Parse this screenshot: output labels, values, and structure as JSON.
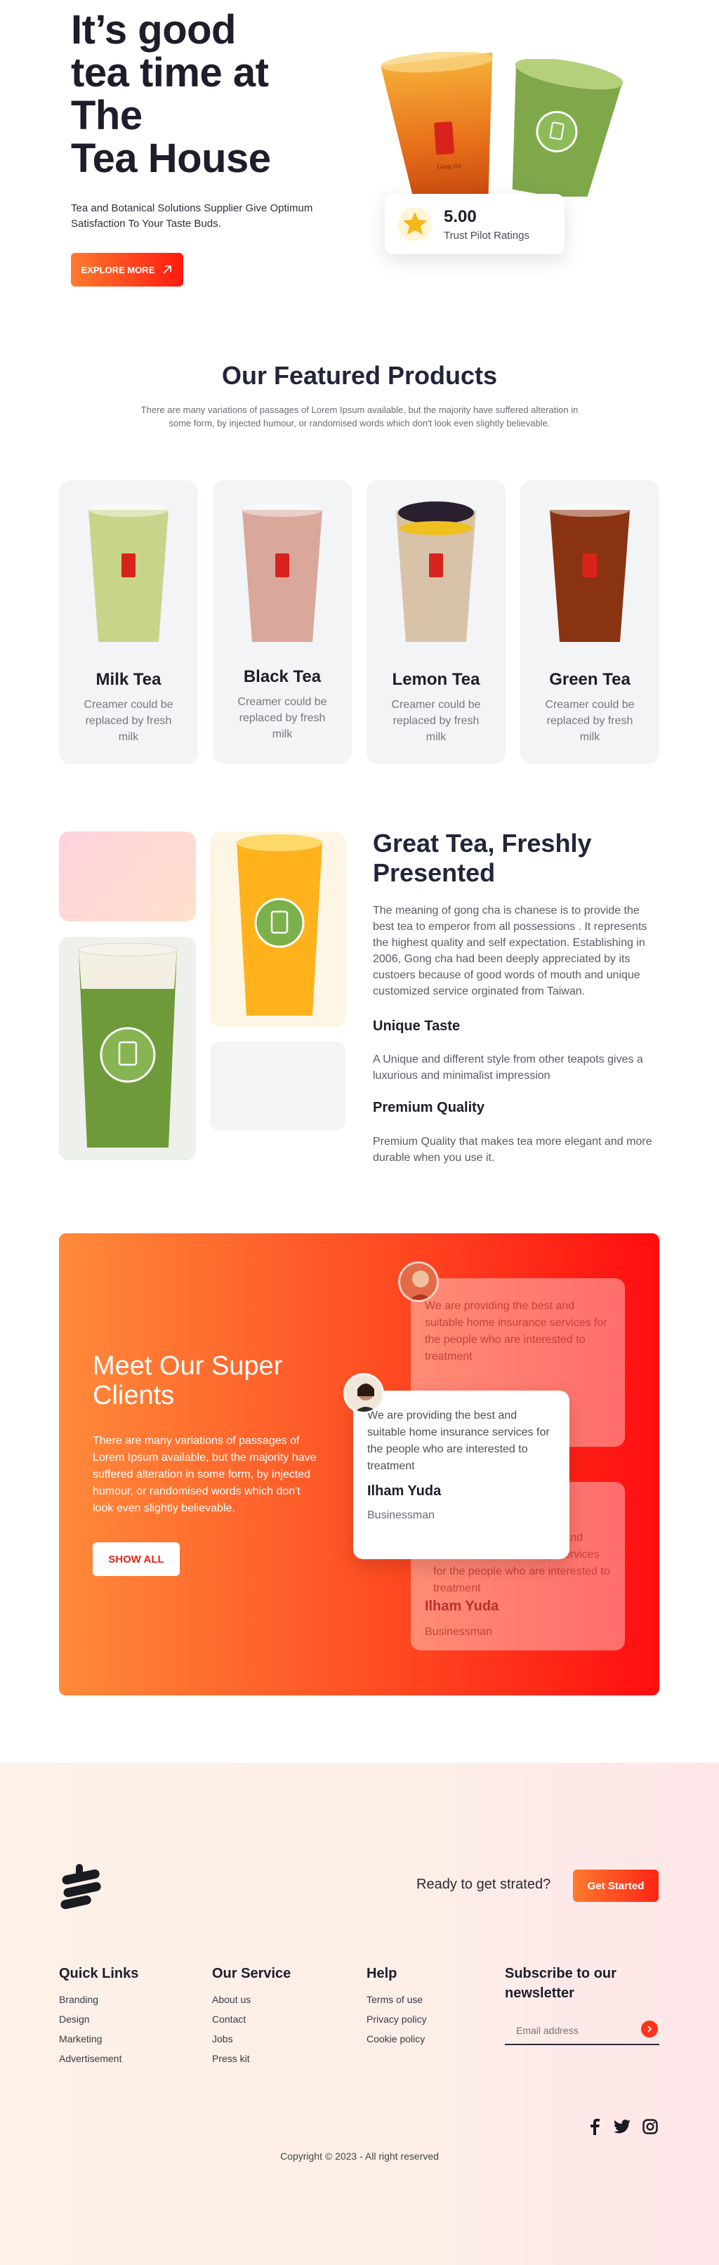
{
  "hero": {
    "title": "It’s good\ntea time at\nThe\nTea House",
    "subtitle": "Tea and Botanical Solutions Supplier Give Optimum Satisfaction To Your Taste Buds.",
    "cta_label": "EXPLORE MORE",
    "cup_logo_text": "Gong cha",
    "rating_value": "5.00",
    "rating_label": "Trust Pilot Ratings"
  },
  "featured": {
    "title": "Our Featured Products",
    "subtitle": "There are many variations of passages of Lorem Ipsum available, but the majority have suffered alteration in some form, by injected humour, or randomised words which don't look even slightly believable.",
    "products": [
      {
        "name": "Milk Tea",
        "desc": "Creamer could be replaced by fresh milk",
        "color": "#c8d48a"
      },
      {
        "name": "Black Tea",
        "desc": "Creamer could be replaced by fresh milk",
        "color": "#d9a89a"
      },
      {
        "name": "Lemon Tea",
        "desc": "Creamer could be replaced by fresh milk",
        "color": "#d8c3a8"
      },
      {
        "name": "Green Tea",
        "desc": "Creamer could be replaced by fresh milk",
        "color": "#8a3312"
      }
    ]
  },
  "great_tea": {
    "title": "Great Tea, Freshly Presented",
    "body": "The meaning of gong cha is chanese is to provide the best tea to emperor from all possessions . It represents the highest quality and self expectation. Establishing in 2006, Gong cha had been deeply appreciated by its custoers because of good words of mouth and unique customized service orginated from Taiwan.",
    "features": [
      {
        "title": "Unique Taste",
        "body": "A Unique and different style from other teapots gives a luxurious and minimalist impression"
      },
      {
        "title": "Premium Quality",
        "body": "Premium Quality that makes tea more elegant and more durable when you use it."
      }
    ]
  },
  "clients": {
    "title": "Meet Our Super Clients",
    "text": "There are many variations of passages of Lorem Ipsum available, but the majority have suffered alteration in some form, by injected humour, or randomised words which don't look even slightly believable.",
    "button": "SHOW ALL",
    "testimonials": [
      {
        "quote": "We are providing the best and suitable home insurance services for the people who are interested to treatment"
      },
      {
        "quote": "We are providing the best and suitable home insurance services for the people who are interested to treatment",
        "name": "Ilham Yuda",
        "role": "Businessman"
      },
      {
        "quote": "We are providing the best and suitable home insurance services for the people who are interested to treatment",
        "name": "Ilham Yuda",
        "role": "Businessman"
      }
    ]
  },
  "footer": {
    "cta_text": "Ready to get strated?",
    "cta_button": "Get Started",
    "columns": [
      {
        "title": "Quick Links",
        "links": [
          "Branding",
          "Design",
          "Marketing",
          "Advertisement"
        ]
      },
      {
        "title": "Our Service",
        "links": [
          "About us",
          "Contact",
          "Jobs",
          "Press kit"
        ]
      },
      {
        "title": "Help",
        "links": [
          "Terms of use",
          "Privacy policy",
          "Cookie policy"
        ]
      }
    ],
    "newsletter_title": "Subscribe to our newsletter",
    "email_placeholder": "Email address",
    "copyright": "Copyright © 2023 - All right reserved"
  },
  "colors": {
    "accent": "#ff3418",
    "accent_start": "#ff7a2e",
    "dark": "#1d1d2c"
  }
}
